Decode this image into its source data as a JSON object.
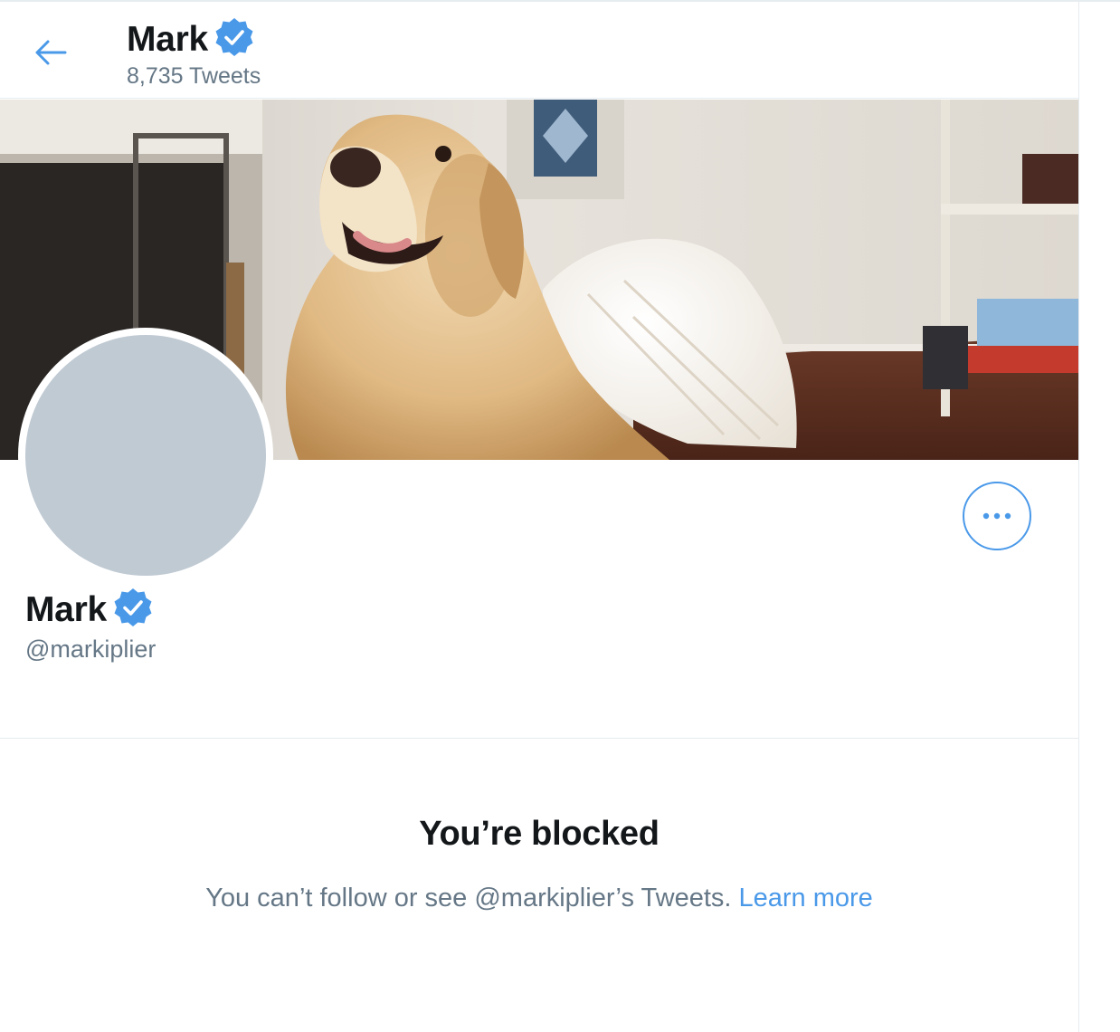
{
  "header": {
    "name": "Mark",
    "tweet_count": "8,735 Tweets"
  },
  "profile": {
    "name": "Mark",
    "handle": "@markiplier"
  },
  "blocked": {
    "title": "You’re blocked",
    "message": "You can’t follow or see @markiplier’s Tweets.",
    "link_label": "Learn more"
  },
  "icons": {
    "back": "arrow-left-icon",
    "verified": "verified-badge-icon",
    "more": "more-horizontal-icon"
  },
  "colors": {
    "accent": "#4a99e9",
    "text_primary": "#14171a",
    "text_secondary": "#657786",
    "avatar_placeholder": "#c0cad3"
  }
}
